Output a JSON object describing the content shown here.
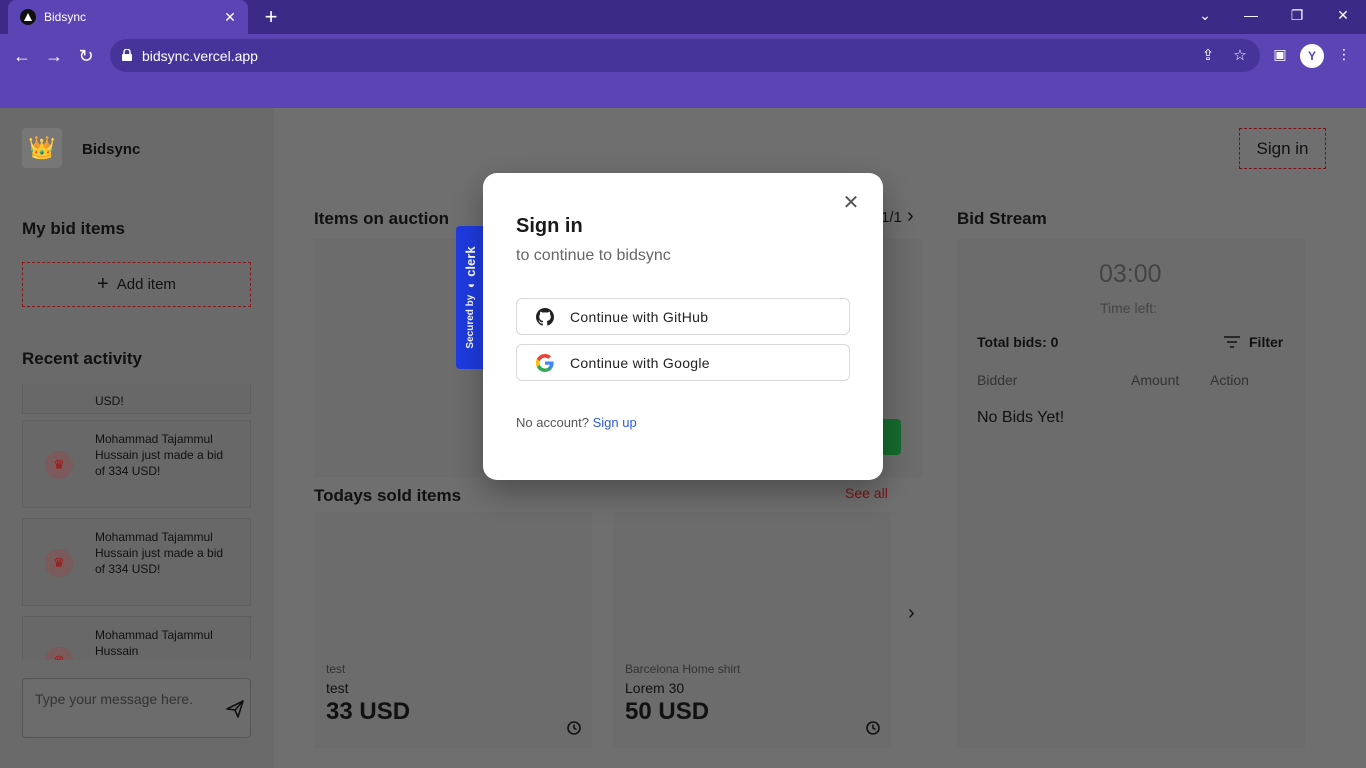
{
  "browser": {
    "tab_title": "Bidsync",
    "tab_close": "✕",
    "new_tab": "+",
    "url": "bidsync.vercel.app",
    "profile_initial": "Y"
  },
  "app": {
    "name": "Bidsync",
    "sign_in_button": "Sign in"
  },
  "sidebar": {
    "my_bid_items": "My bid items",
    "add_item": "Add item",
    "recent_activity": "Recent activity",
    "activities": [
      {
        "text": "USD!"
      },
      {
        "text": "Mohammad Tajammul Hussain just made a bid of 334 USD!"
      },
      {
        "text": "Mohammad Tajammul Hussain just made a bid of 334 USD!"
      },
      {
        "text": "Mohammad Tajammul Hussain"
      }
    ],
    "message_placeholder": "Type your message here."
  },
  "main": {
    "items_on_auction": "Items on auction",
    "pagination": "1/1",
    "todays_sold_items": "Todays sold items",
    "see_all": "See all",
    "sold_items": [
      {
        "category": "test",
        "name": "test",
        "price": "33 USD"
      },
      {
        "category": "Barcelona Home shirt",
        "name": "Lorem 30",
        "price": "50 USD"
      }
    ]
  },
  "bid_stream": {
    "title": "Bid Stream",
    "timer": "03:00",
    "time_left_label": "Time left:",
    "total_bids": "Total bids: 0",
    "filter": "Filter",
    "columns": [
      "Bidder",
      "Amount",
      "Action"
    ],
    "empty": "No Bids Yet!"
  },
  "modal": {
    "title": "Sign in",
    "subtitle": "to continue to bidsync",
    "github_button": "Continue with GitHub",
    "google_button": "Continue with Google",
    "no_account": "No account?",
    "sign_up": "Sign up",
    "secured_by": "Secured by",
    "clerk": "clerk"
  },
  "colors": {
    "browser_frame": "#3b2a86",
    "browser_toolbar": "#5b44b3",
    "clerk_blue": "#1f3be0",
    "link_blue": "#2f5bd9"
  }
}
